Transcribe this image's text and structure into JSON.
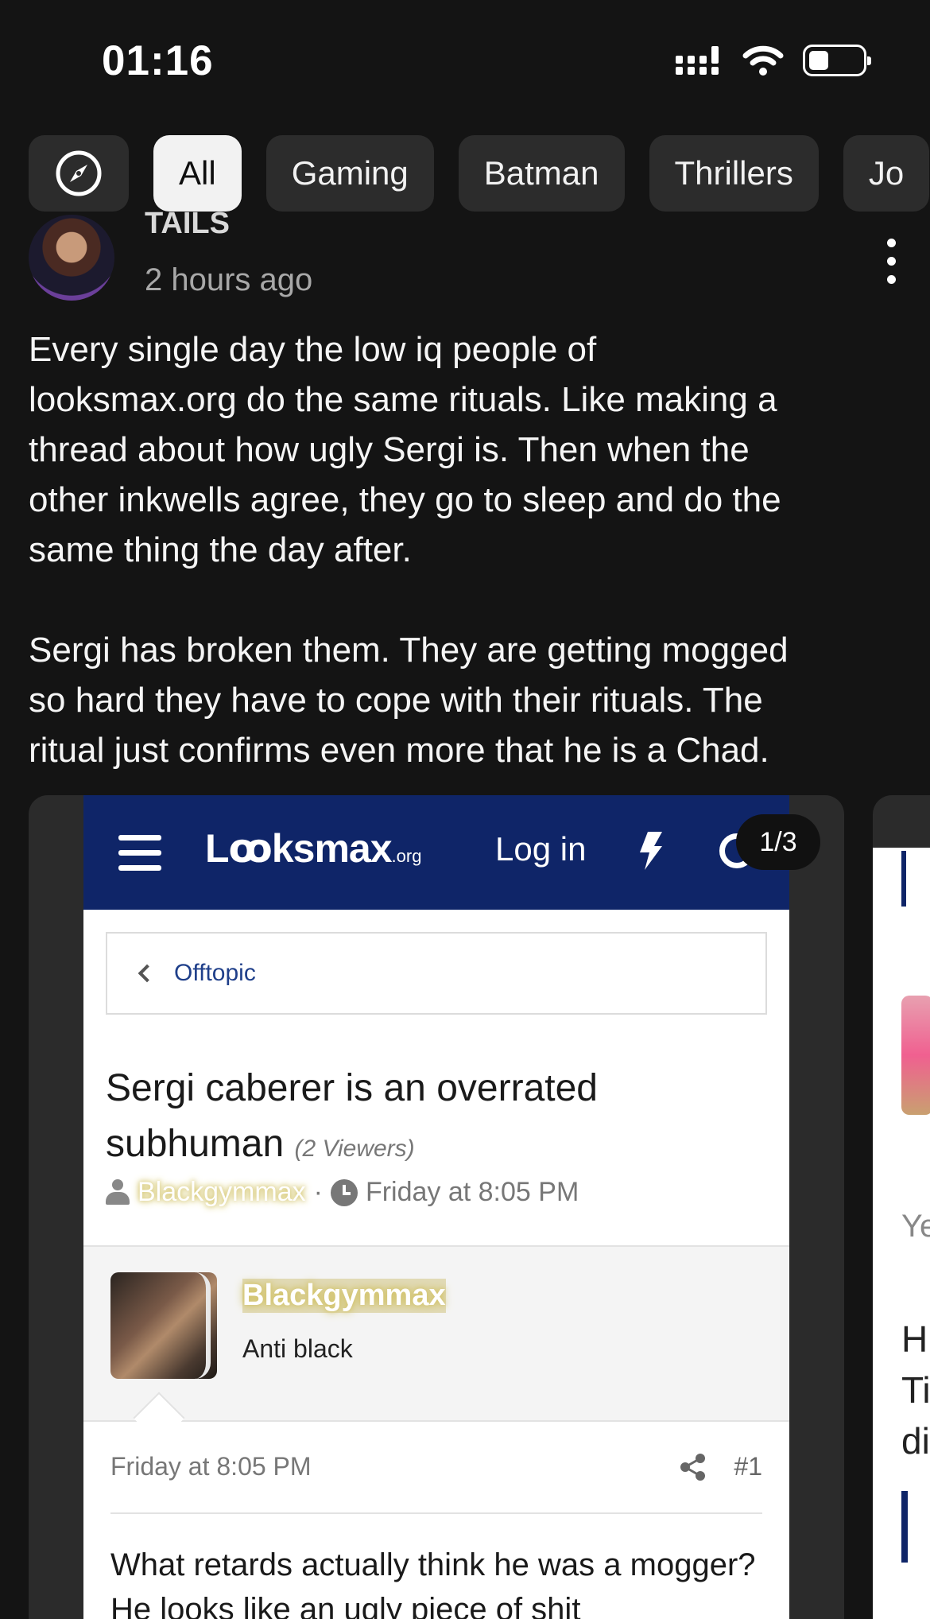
{
  "status_bar": {
    "time": "01:16"
  },
  "chips": [
    {
      "label": "All",
      "active": true
    },
    {
      "label": "Gaming"
    },
    {
      "label": "Batman"
    },
    {
      "label": "Thrillers"
    },
    {
      "label": "Jo"
    }
  ],
  "post": {
    "username": "TAILS",
    "time_ago": "2 hours ago",
    "paragraphs": [
      "Every single day the low iq people of\nlooksmax.org do the same rituals. Like making a\nthread about how ugly Sergi is. Then when the\nother inkwells agree, they go to sleep and do the\nsame thing the day after.",
      "Sergi has broken them. They are getting mogged\nso hard they have to cope with their rituals. The\nritual just confirms even more that he is a Chad."
    ],
    "media_counter": "1/3"
  },
  "screenshot": {
    "brand": "Lꝏksmax",
    "brand_suffix": ".org",
    "login": "Log in",
    "breadcrumb": "Offtopic",
    "thread_title": "Sergi caberer is an overrated subhuman",
    "viewers": "(2 Viewers)",
    "author": "Blackgymmax",
    "separator": "·",
    "date": "Friday at 8:05 PM",
    "user_name": "Blackgymmax",
    "user_title": "Anti black",
    "post_date": "Friday at 8:05 PM",
    "post_number": "#1",
    "post_body": "What retards actually think he was a mogger? He looks like an ugly piece of shit"
  },
  "next_card": {
    "text1": "Ye",
    "text2": "H\nTi\ndi"
  }
}
